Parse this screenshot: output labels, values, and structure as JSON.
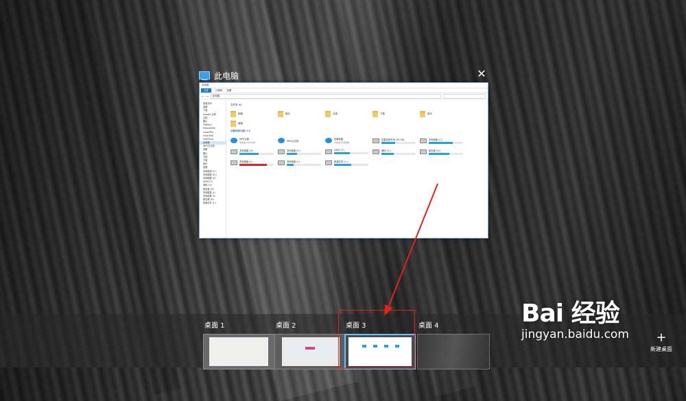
{
  "window": {
    "title": "此电脑",
    "close_glyph": "✕",
    "explorer": {
      "titlebar": "此电脑",
      "ribbon_tabs": [
        "文件",
        "计算机",
        "查看"
      ],
      "address": "此电脑",
      "nav_items": [
        "快速访问",
        "桌面",
        "下载",
        "Google 云端",
        "文档",
        "图片",
        "FileRecv",
        "ModuleHist",
        "chaoYFile",
        "shayuFile",
        "OneDrive",
        "此电脑",
        "WPS云文档",
        "视频",
        "图片",
        "文档",
        "下载",
        "音乐",
        "桌面",
        "本地磁盘 (C:)",
        "本地磁盘 (D:)",
        "本地磁盘 (E:)",
        "DATA (F:)",
        "源码 (G:)",
        "新加卷 (H:)",
        "本地磁盘 (I:)",
        "本地磁盘 (J:)",
        "新加卷 (K:)",
        "极速共享 (L:)"
      ],
      "folders_header": "文件夹 (6)",
      "folders": [
        "视频",
        "图片",
        "文档",
        "下载",
        "音乐",
        "桌面"
      ],
      "drives_header": "设备和驱动器 (13)",
      "drives": [
        {
          "name": "WPS云盘",
          "fill": 0,
          "sub": "双击进入WPS云盘",
          "type": "cloud"
        },
        {
          "name": "WPS云文档",
          "fill": 0,
          "sub": "",
          "type": "cloud"
        },
        {
          "name": "百度网盘",
          "fill": 0,
          "sub": "双击运行百度网盘",
          "type": "cloud"
        },
        {
          "name": "迅雷影音专用 (30 GB)",
          "fill": 0.4,
          "sub": "",
          "type": "drive"
        },
        {
          "name": "本地磁盘 (C:)",
          "fill": 0.7,
          "sub": "",
          "type": "drive"
        },
        {
          "name": "本地磁盘 (D:)",
          "fill": 0.55,
          "sub": "",
          "type": "drive"
        },
        {
          "name": "本地磁盘 (E:)",
          "fill": 0.3,
          "sub": "",
          "type": "drive"
        },
        {
          "name": "DATA (F:)",
          "fill": 0.45,
          "sub": "",
          "type": "drive"
        },
        {
          "name": "源码 (G:)",
          "fill": 0.35,
          "sub": "",
          "type": "drive"
        },
        {
          "name": "新加卷 (H:)",
          "fill": 0.6,
          "sub": "",
          "type": "drive"
        },
        {
          "name": "本地磁盘 (I:)",
          "fill": 0.8,
          "sub": "",
          "type": "drive"
        },
        {
          "name": "本地磁盘 (J:)",
          "fill": 0.2,
          "sub": "",
          "type": "drive"
        },
        {
          "name": "极速共享 (L:)",
          "fill": 0.5,
          "sub": "",
          "type": "drive"
        }
      ]
    }
  },
  "desktops": [
    {
      "label": "桌面 1",
      "active": false
    },
    {
      "label": "桌面 2",
      "active": false
    },
    {
      "label": "桌面 3",
      "active": true
    },
    {
      "label": "桌面 4",
      "active": false
    }
  ],
  "new_desktop": {
    "glyph": "+",
    "label": "新建桌面"
  },
  "watermark": {
    "logo": "Bai 经验",
    "url": "jingyan.baidu.com"
  },
  "colors": {
    "highlight_red": "#e2231a",
    "active_border": "#6ac1ff",
    "accent_blue": "#26a0da"
  },
  "icons": {
    "title_icon": "this-pc-icon",
    "close": "close-icon"
  }
}
